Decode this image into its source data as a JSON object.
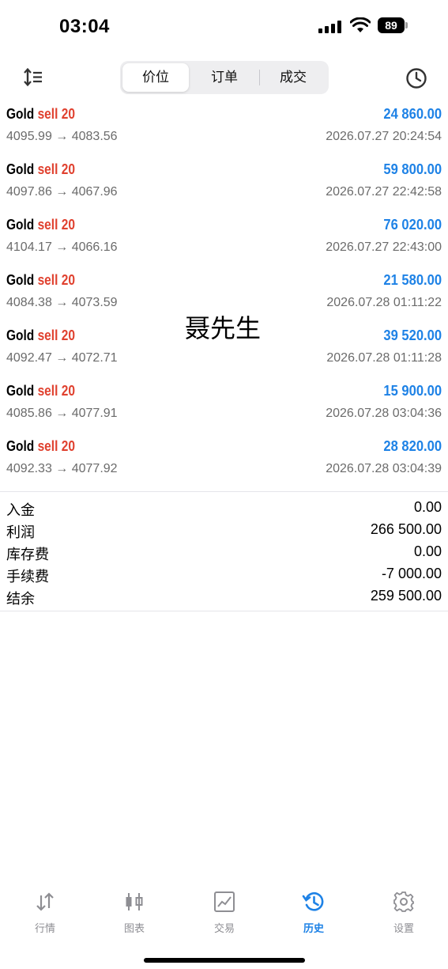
{
  "status_bar": {
    "time": "03:04",
    "battery": "89"
  },
  "segments": [
    {
      "label": "价位",
      "active": true
    },
    {
      "label": "订单",
      "active": false
    },
    {
      "label": "成交",
      "active": false
    }
  ],
  "icons": {
    "sort": "sort-icon",
    "history_clock": "clock-icon"
  },
  "deals": [
    {
      "symbol": "Gold",
      "side": "sell",
      "volume": "20",
      "prices": "4095.99 → 4083.56",
      "profit": "24 860.00",
      "time": "2026.07.27 20:24:54"
    },
    {
      "symbol": "Gold",
      "side": "sell",
      "volume": "20",
      "prices": "4097.86 → 4067.96",
      "profit": "59 800.00",
      "time": "2026.07.27 22:42:58"
    },
    {
      "symbol": "Gold",
      "side": "sell",
      "volume": "20",
      "prices": "4104.17 → 4066.16",
      "profit": "76 020.00",
      "time": "2026.07.27 22:43:00"
    },
    {
      "symbol": "Gold",
      "side": "sell",
      "volume": "20",
      "prices": "4084.38 → 4073.59",
      "profit": "21 580.00",
      "time": "2026.07.28 01:11:22"
    },
    {
      "symbol": "Gold",
      "side": "sell",
      "volume": "20",
      "prices": "4092.47 → 4072.71",
      "profit": "39 520.00",
      "time": "2026.07.28 01:11:28"
    },
    {
      "symbol": "Gold",
      "side": "sell",
      "volume": "20",
      "prices": "4085.86 → 4077.91",
      "profit": "15 900.00",
      "time": "2026.07.28 03:04:36"
    },
    {
      "symbol": "Gold",
      "side": "sell",
      "volume": "20",
      "prices": "4092.33 → 4077.92",
      "profit": "28 820.00",
      "time": "2026.07.28 03:04:39"
    }
  ],
  "watermark": "聂先生",
  "summary": [
    {
      "label": "入金",
      "value": "0.00"
    },
    {
      "label": "利润",
      "value": "266 500.00"
    },
    {
      "label": "库存费",
      "value": "0.00"
    },
    {
      "label": "手续费",
      "value": "-7 000.00"
    },
    {
      "label": "结余",
      "value": "259 500.00"
    }
  ],
  "tabbar": [
    {
      "label": "行情",
      "icon": "quotes-arrows-icon",
      "active": false
    },
    {
      "label": "图表",
      "icon": "candlestick-chart-icon",
      "active": false
    },
    {
      "label": "交易",
      "icon": "trade-chart-icon",
      "active": false
    },
    {
      "label": "历史",
      "icon": "history-icon",
      "active": true
    },
    {
      "label": "设置",
      "icon": "gear-icon",
      "active": false
    }
  ],
  "colors": {
    "profit_blue": "#1e82e6",
    "sell_red": "#e0412f",
    "tab_active": "#1e82e6",
    "tab_inactive": "#8e8e93",
    "secondary_text": "#6b6b6b"
  }
}
